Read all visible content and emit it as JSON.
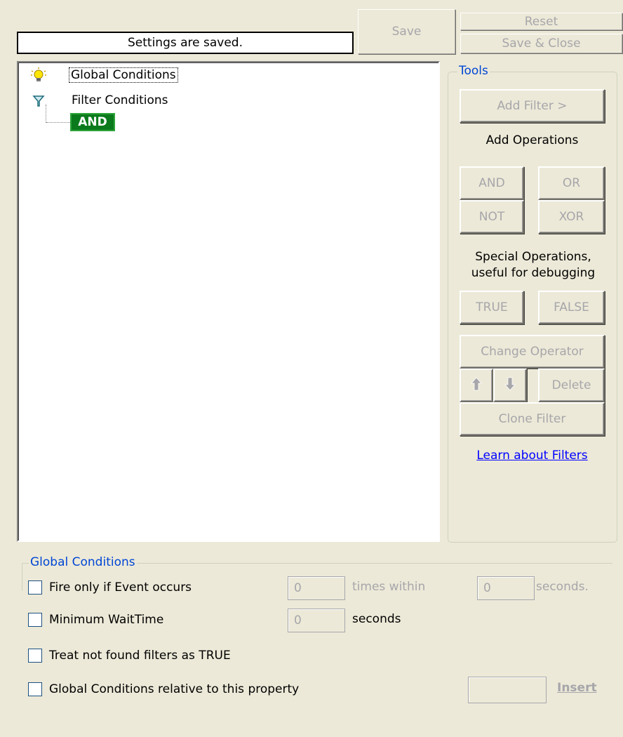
{
  "status": {
    "text": "Settings are saved."
  },
  "top_buttons": {
    "save": "Save",
    "reset": "Reset",
    "save_close": "Save & Close"
  },
  "tree": {
    "items": [
      {
        "label": "Global Conditions",
        "icon": "lightbulb-icon",
        "selected": true
      },
      {
        "label": "Filter Conditions",
        "icon": "funnel-icon"
      }
    ],
    "operator": "AND"
  },
  "tools": {
    "title": "Tools",
    "add_filter": "Add Filter >",
    "add_operations_label": "Add Operations",
    "and": "AND",
    "or": "OR",
    "not": "NOT",
    "xor": "XOR",
    "special_label_line1": "Special Operations,",
    "special_label_line2": "useful for debugging",
    "true_btn": "TRUE",
    "false_btn": "FALSE",
    "change_operator": "Change Operator",
    "delete": "Delete",
    "clone_filter": "Clone Filter",
    "learn_link": "Learn about Filters"
  },
  "global_conditions": {
    "title": "Global Conditions",
    "fire_only_label": "Fire only if Event occurs",
    "fire_count_value": "0",
    "times_within_label": "times within",
    "fire_seconds_value": "0",
    "seconds_label": "seconds.",
    "min_wait_label": "Minimum WaitTime",
    "min_wait_value": "0",
    "min_wait_unit": "seconds",
    "treat_not_found_label": "Treat not found filters as TRUE",
    "relative_label": "Global Conditions relative to this property",
    "relative_value": "",
    "insert_label": "Insert"
  },
  "colors": {
    "operator_bg": "#0a7a1c",
    "link": "#0000ff",
    "group_title": "#0046d5"
  }
}
